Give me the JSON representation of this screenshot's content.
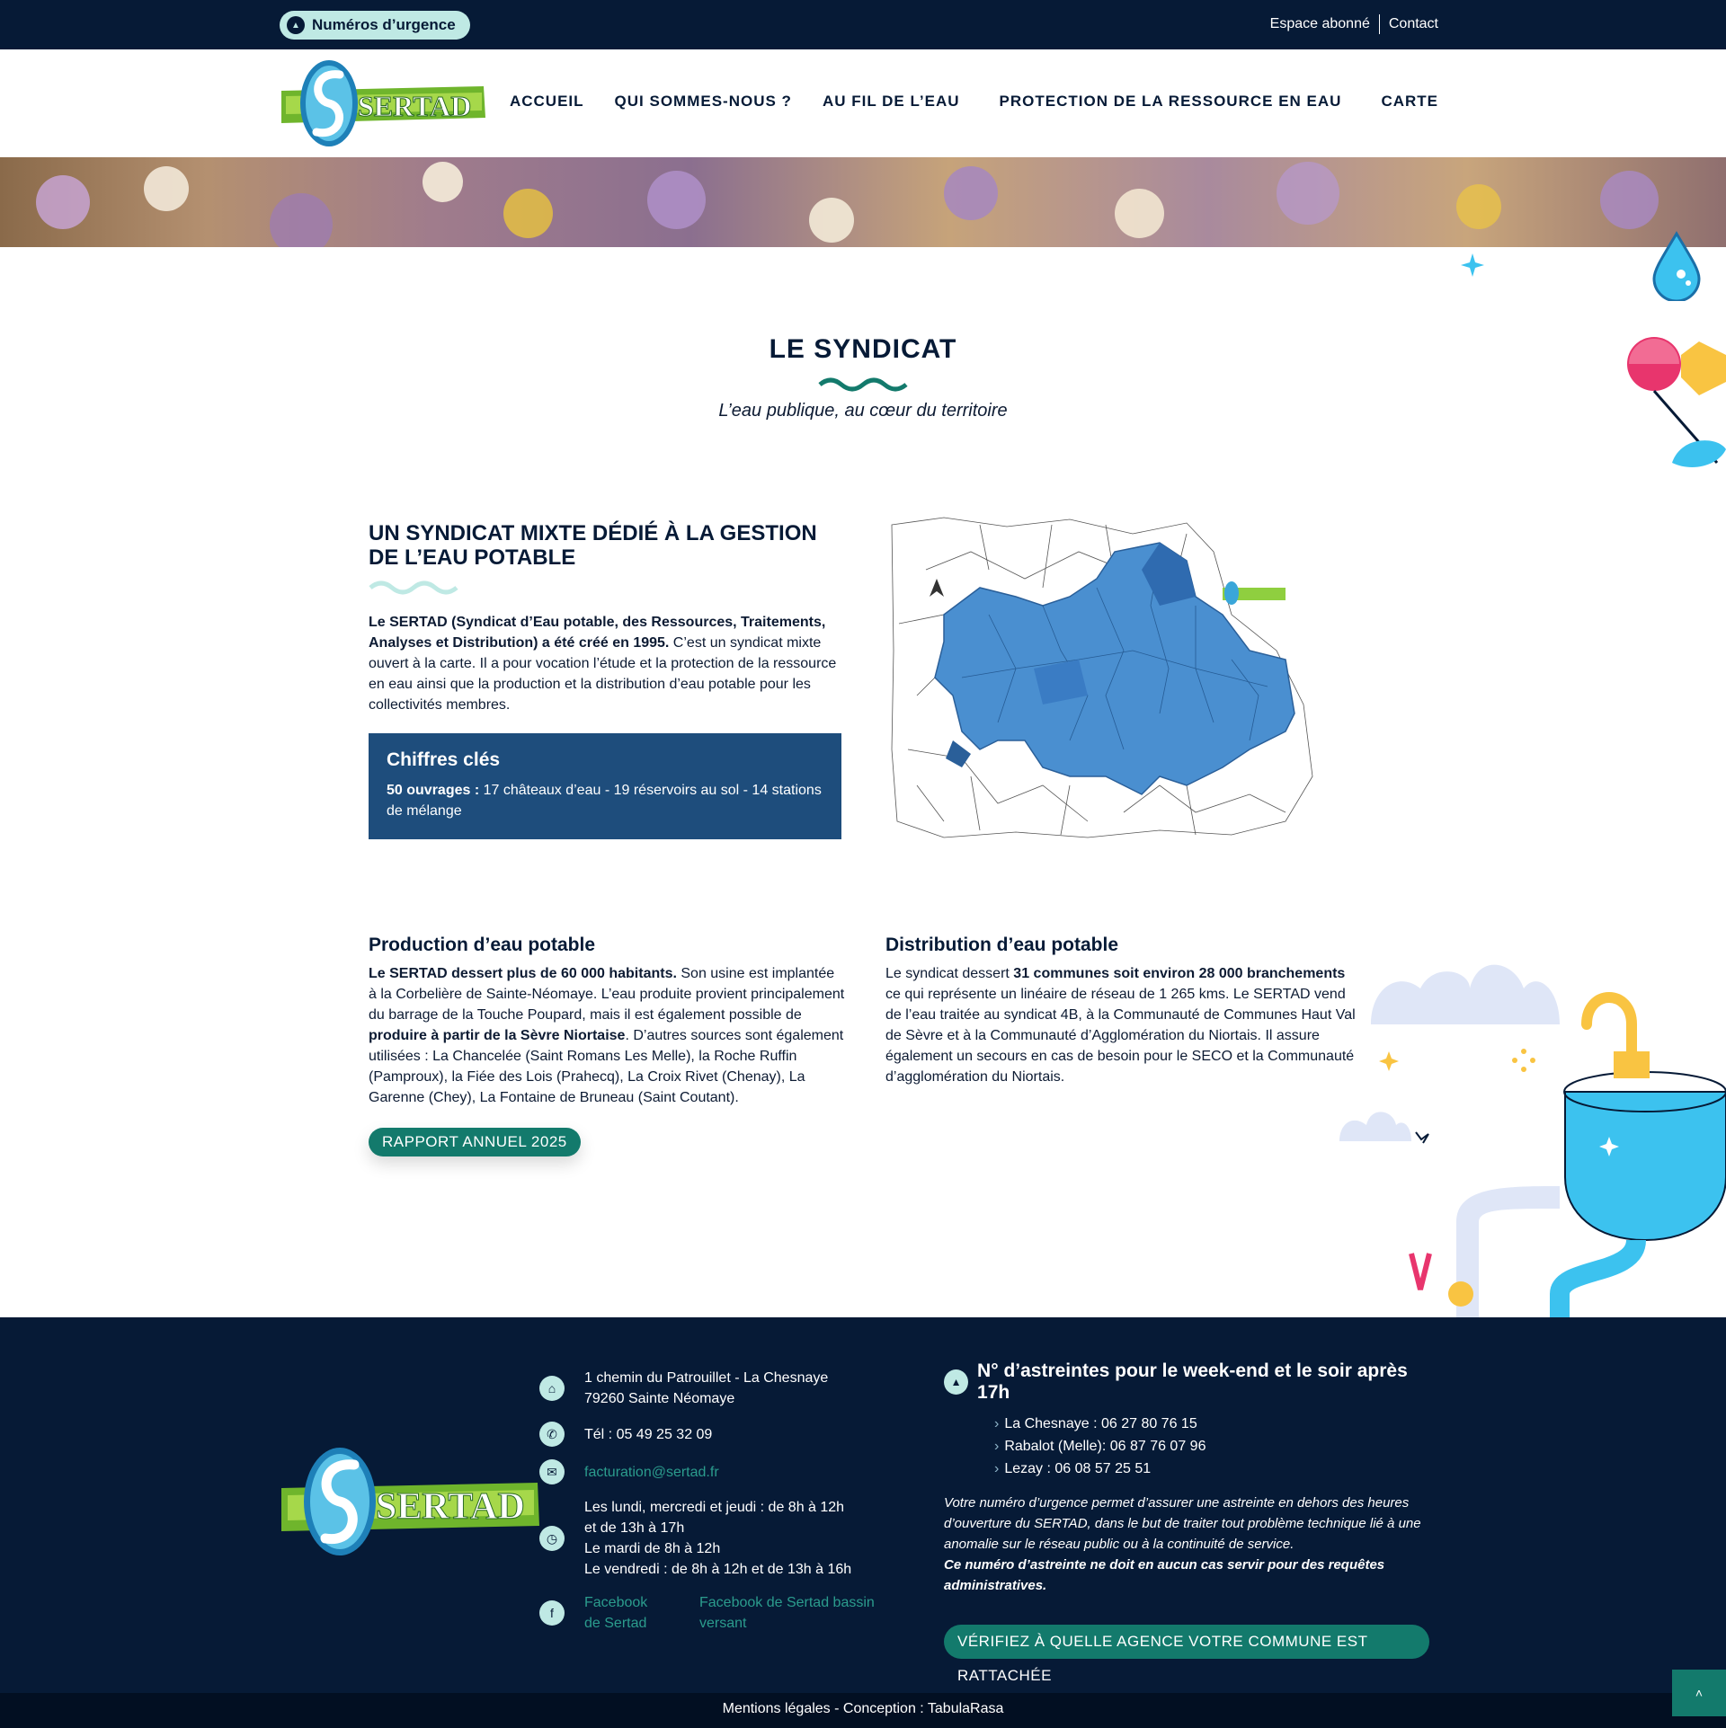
{
  "topbar": {
    "urgence_label": "Numéros d’urgence",
    "espace_abonne": "Espace abonné",
    "contact": "Contact"
  },
  "logo_text": "SERTAD",
  "nav": {
    "items": [
      {
        "label": "ACCUEIL"
      },
      {
        "label": "QUI SOMMES-NOUS ?"
      },
      {
        "label": "AU FIL DE L’EAU"
      },
      {
        "label": "PROTECTION DE LA RESSOURCE EN EAU"
      },
      {
        "label": "CARTE"
      }
    ]
  },
  "section": {
    "title": "LE SYNDICAT",
    "subtitle": "L’eau publique, au cœur du territoire"
  },
  "intro": {
    "heading": "UN SYNDICAT MIXTE DÉDIÉ À LA GESTION DE L’EAU POTABLE",
    "bold": "Le SERTAD (Syndicat d’Eau potable, des Ressources, Traitements, Analyses et Distribution) a été créé en 1995.",
    "text": " C’est un syndicat mixte ouvert à la carte. Il a pour vocation l’étude et la protection de la ressource en eau ainsi que la production et la distribution d’eau potable pour les collectivités membres.",
    "key_title": "Chiffres clés",
    "key_bold": "50 ouvrages :",
    "key_text": " 17 châteaux d’eau - 19 réservoirs au sol - 14 stations de mélange"
  },
  "production": {
    "heading": "Production d’eau potable",
    "bold1": "Le SERTAD dessert plus de 60 000 habitants.",
    "text1": " Son usine est implantée à la Corbelière de Sainte-Néomaye. L’eau produite provient principalement du barrage de la Touche Poupard, mais il est également possible de ",
    "bold2": "produire à partir de la Sèvre Niortaise",
    "text2": ". D’autres sources sont également utilisées : La Chancelée (Saint Romans Les Melle), la Roche Ruffin (Pamproux), la Fiée des Lois (Prahecq), La Croix Rivet (Chenay), La Garenne (Chey), La Fontaine de Bruneau (Saint Coutant).",
    "button": "RAPPORT ANNUEL 2025"
  },
  "distribution": {
    "heading": "Distribution d’eau potable",
    "text1": "Le syndicat dessert ",
    "bold1": "31 communes soit environ 28 000 branchements",
    "text2": " ce qui représente un linéaire de réseau de 1 265 kms. Le SERTAD vend de l’eau traitée au syndicat 4B, à la Communauté de Communes Haut Val de Sèvre et à la Communauté d’Agglomération du Niortais. Il assure également un secours en cas de besoin pour le SECO et la Communauté d’agglomération du Niortais."
  },
  "footer": {
    "address1": "1 chemin du Patrouillet - La Chesnaye",
    "address2": "79260 Sainte Néomaye",
    "tel": "Tél : 05 49 25 32 09",
    "email": "facturation@sertad.fr",
    "hours": [
      "Les lundi, mercredi et jeudi : de 8h à 12h",
      "et de 13h à 17h",
      "Le mardi de 8h à 12h",
      "Le vendredi : de 8h à 12h et de 13h à 16h"
    ],
    "fb1": "Facebook de Sertad",
    "fb2": "Facebook de Sertad bassin versant",
    "astreinte_title": "N° d’astreintes pour le week-end et le soir après 17h",
    "astreintes": [
      "La Chesnaye : 06 27 80 76 15",
      "Rabalot (Melle): 06 87 76 07 96",
      "Lezay : 06 08 57 25 51"
    ],
    "note": "Votre numéro d’urgence permet d’assurer une astreinte en dehors des heures d’ouverture du SERTAD, dans le but de traiter tout problème technique lié à une anomalie sur le réseau public ou à la continuité de service.",
    "note_bold": "Ce numéro d’astreinte ne doit en aucun cas servir pour des requêtes administratives.",
    "verif_button": "VÉRIFIEZ À QUELLE AGENCE VOTRE COMMUNE EST RATTACHÉE"
  },
  "bottom": {
    "text": "Mentions légales - Conception : TabulaRasa"
  },
  "colors": {
    "navy": "#061a36",
    "teal": "#137a6c",
    "mint": "#bfe9e4",
    "box_blue": "#1e4d7c",
    "map_blue": "#4a8fd0"
  }
}
